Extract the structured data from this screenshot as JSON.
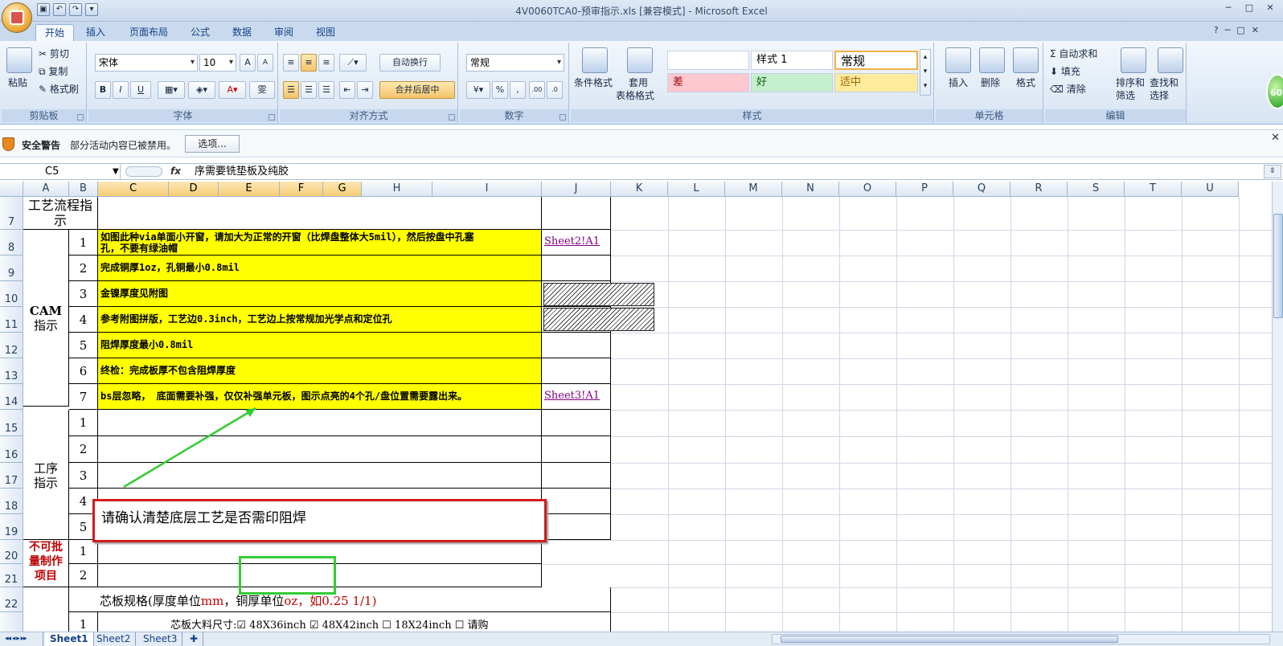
{
  "window": {
    "title": "4V0060TCA0-预审指示.xls  [兼容模式] - Microsoft Excel",
    "controls": [
      "─",
      "□",
      "✕"
    ]
  },
  "qat": {
    "save_icon": "save-icon",
    "undo_icon": "undo-icon",
    "redo_icon": "redo-icon"
  },
  "tabs": [
    "开始",
    "插入",
    "页面布局",
    "公式",
    "数据",
    "审阅",
    "视图"
  ],
  "active_tab": "开始",
  "ribbon": {
    "clipboard": {
      "label": "剪贴板",
      "paste": "粘贴",
      "cut": "剪切",
      "copy": "复制",
      "format_painter": "格式刷"
    },
    "font": {
      "label": "字体",
      "name": "宋体",
      "size": "10",
      "bold": "B",
      "italic": "I",
      "underline": "U",
      "grow": "A",
      "shrink": "A",
      "wen": "雯"
    },
    "alignment": {
      "label": "对齐方式",
      "wrap": "自动换行",
      "merge": "合并后居中"
    },
    "number": {
      "label": "数字",
      "format": "常规",
      "percent": "%",
      "comma": ",",
      "inc": ".00",
      "dec": ".0"
    },
    "styles": {
      "label": "样式",
      "cond_format": "条件格式",
      "table_format_1": "套用",
      "table_format_2": "表格格式",
      "style1": "样式 1",
      "normal": "常规",
      "bad": "差",
      "good": "好",
      "neutral": "适中",
      "blank": ""
    },
    "cells": {
      "label": "单元格",
      "insert": "插入",
      "delete": "删除",
      "format": "格式"
    },
    "editing": {
      "label": "编辑",
      "autosum": "自动求和",
      "fill": "填充",
      "clear": "清除",
      "sort_1": "排序和",
      "sort_2": "筛选",
      "find_1": "查找和",
      "find_2": "选择"
    }
  },
  "security": {
    "title": "安全警告",
    "text": "部分活动内容已被禁用。",
    "button": "选项..."
  },
  "formula_bar": {
    "name_box": "C5",
    "fx": "fx",
    "formula": "序需要铣垫板及纯胶"
  },
  "columns": [
    "A",
    "B",
    "C",
    "D",
    "E",
    "F",
    "G",
    "H",
    "I",
    "J",
    "K",
    "L",
    "M",
    "N",
    "O",
    "P",
    "Q",
    "R",
    "S",
    "T",
    "U"
  ],
  "rows": [
    "7",
    "8",
    "9",
    "10",
    "11",
    "12",
    "13",
    "14",
    "15",
    "16",
    "17",
    "18",
    "19",
    "20",
    "21",
    "22",
    ""
  ],
  "sheet": {
    "header_a7": "工艺流程指示",
    "cam_label_1": "CAM",
    "cam_label_2": "指示",
    "process_label_1": "工序",
    "process_label_2": "指示",
    "nonbatch_1": "不可批",
    "nonbatch_2": "量制作",
    "nonbatch_3": "项目",
    "cam_items": [
      {
        "no": "1",
        "text1": "如图此种via单面小开窗，请加大为正常的开窗（比焊盘整体大5mil），然后按盘中孔塞",
        "text2": "孔，不要有绿油帽",
        "link": "Sheet2!A1"
      },
      {
        "no": "2",
        "text1": "完成铜厚1oz，孔铜最小0.8mil",
        "text2": "",
        "link": ""
      },
      {
        "no": "3",
        "text1": "金镍厚度见附图",
        "text2": "",
        "link": ""
      },
      {
        "no": "4",
        "text1": "参考附图拼版，工艺边0.3inch，工艺边上按常规加光学点和定位孔",
        "text2": "",
        "link": ""
      },
      {
        "no": "5",
        "text1": "阻焊厚度最小0.8mil",
        "text2": "",
        "link": ""
      },
      {
        "no": "6",
        "text1": "终检：完成板厚不包含阻焊厚度",
        "text2": "",
        "link": ""
      },
      {
        "no": "7",
        "text1": "bs层忽略， 底面需要补强，仅仅补强单元板，图示点亮的4个孔/盘位置需要露出来。",
        "text2": "",
        "link": "Sheet3!A1"
      }
    ],
    "process_nos": [
      "1",
      "2",
      "3",
      "4",
      "5"
    ],
    "nonbatch_nos": [
      "1",
      "2"
    ],
    "row22_a": "芯板规格(厚度单位",
    "row22_b": "mm",
    "row22_c": "，铜厚单位",
    "row22_d": "oz",
    "row22_e": "，如0.25 1/1)",
    "row23_no": "1",
    "row23_text": "芯板大料尺寸:☑ 48X36inch ☑ 48X42inch ☐ 18X24inch    ☐ 请购"
  },
  "callout": {
    "text": "请确认清楚底层工艺是否需印阻焊"
  },
  "sheet_tabs": [
    "Sheet1",
    "Sheet2",
    "Sheet3"
  ],
  "active_sheet": "Sheet1",
  "badge": "60"
}
